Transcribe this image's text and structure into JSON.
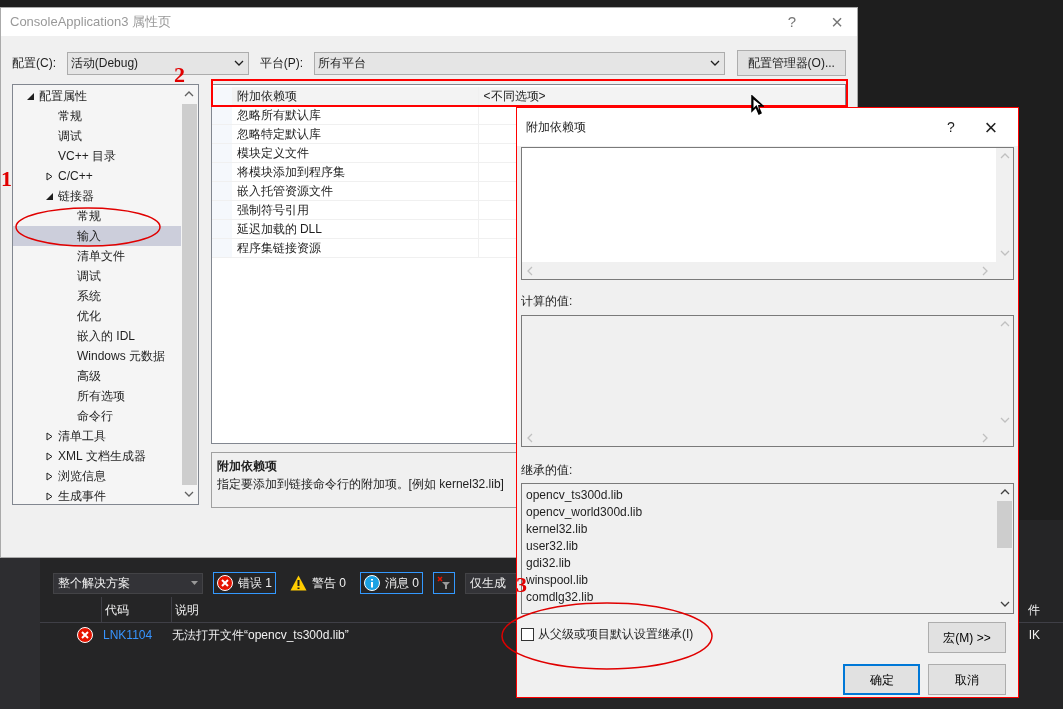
{
  "error_list": {
    "scope": "整个解决方案",
    "filters": [
      {
        "kind": "error",
        "label": "错误 1",
        "selected": true
      },
      {
        "kind": "warning",
        "label": "警告 0",
        "selected": false
      },
      {
        "kind": "message",
        "label": "消息 0",
        "selected": true
      }
    ],
    "build_filter": "仅生成",
    "columns": [
      "代码",
      "说明"
    ],
    "column_4": "件",
    "rows": [
      {
        "kind": "error",
        "code": "LNK1104",
        "description": "无法打开文件“opencv_ts300d.lib”",
        "column_4": "IK"
      }
    ]
  },
  "property_dialog": {
    "title": "ConsoleApplication3 属性页",
    "help": "?",
    "close": "×",
    "configuration": {
      "label": "配置(C):",
      "value": "活动(Debug)"
    },
    "platform": {
      "label": "平台(P):",
      "value": "所有平台"
    },
    "config_manager_button": "配置管理器(O)...",
    "tree": [
      {
        "label": "配置属性",
        "expanded": true,
        "selected": false,
        "children": [
          {
            "label": "常规",
            "selected": false
          },
          {
            "label": "调试",
            "selected": false
          },
          {
            "label": "VC++ 目录",
            "selected": false
          },
          {
            "label": "C/C++",
            "expanded": false,
            "selected": false
          },
          {
            "label": "链接器",
            "expanded": true,
            "selected": false,
            "children": [
              {
                "label": "常规",
                "selected": false
              },
              {
                "label": "输入",
                "selected": true
              },
              {
                "label": "清单文件",
                "selected": false
              },
              {
                "label": "调试",
                "selected": false
              },
              {
                "label": "系统",
                "selected": false
              },
              {
                "label": "优化",
                "selected": false
              },
              {
                "label": "嵌入的 IDL",
                "selected": false
              },
              {
                "label": "Windows 元数据",
                "selected": false
              },
              {
                "label": "高级",
                "selected": false
              },
              {
                "label": "所有选项",
                "selected": false
              },
              {
                "label": "命令行",
                "selected": false
              }
            ]
          },
          {
            "label": "清单工具",
            "expanded": false,
            "selected": false
          },
          {
            "label": "XML 文档生成器",
            "expanded": false,
            "selected": false
          },
          {
            "label": "浏览信息",
            "expanded": false,
            "selected": false
          },
          {
            "label": "生成事件",
            "expanded": false,
            "selected": false
          }
        ]
      }
    ],
    "properties": [
      {
        "name": "附加依赖项",
        "value": "<不同选项>",
        "selected": true
      },
      {
        "name": "忽略所有默认库",
        "selected": false
      },
      {
        "name": "忽略特定默认库",
        "selected": false
      },
      {
        "name": "模块定义文件",
        "selected": false
      },
      {
        "name": "将模块添加到程序集",
        "selected": false
      },
      {
        "name": "嵌入托管资源文件",
        "selected": false
      },
      {
        "name": "强制符号引用",
        "selected": false
      },
      {
        "name": "延迟加载的 DLL",
        "selected": false
      },
      {
        "name": "程序集链接资源",
        "selected": false
      }
    ],
    "description": {
      "title": "附加依赖项",
      "text": "指定要添加到链接命令行的附加项。[例如 kernel32.lib]"
    }
  },
  "edit_dialog": {
    "title": "附加依赖项",
    "help": "?",
    "close": "×",
    "evaluated_label": "计算的值:",
    "inherited_label": "继承的值:",
    "inherited_values": [
      "opencv_ts300d.lib",
      "opencv_world300d.lib",
      "kernel32.lib",
      "user32.lib",
      "gdi32.lib",
      "winspool.lib",
      "comdlg32.lib"
    ],
    "inherit_checkbox": {
      "label": "从父级或项目默认设置继承(I)",
      "checked": false
    },
    "macros_button": "宏(M) >>",
    "ok_button": "确定",
    "cancel_button": "取消"
  },
  "annotations": [
    "1",
    "2",
    "3"
  ]
}
